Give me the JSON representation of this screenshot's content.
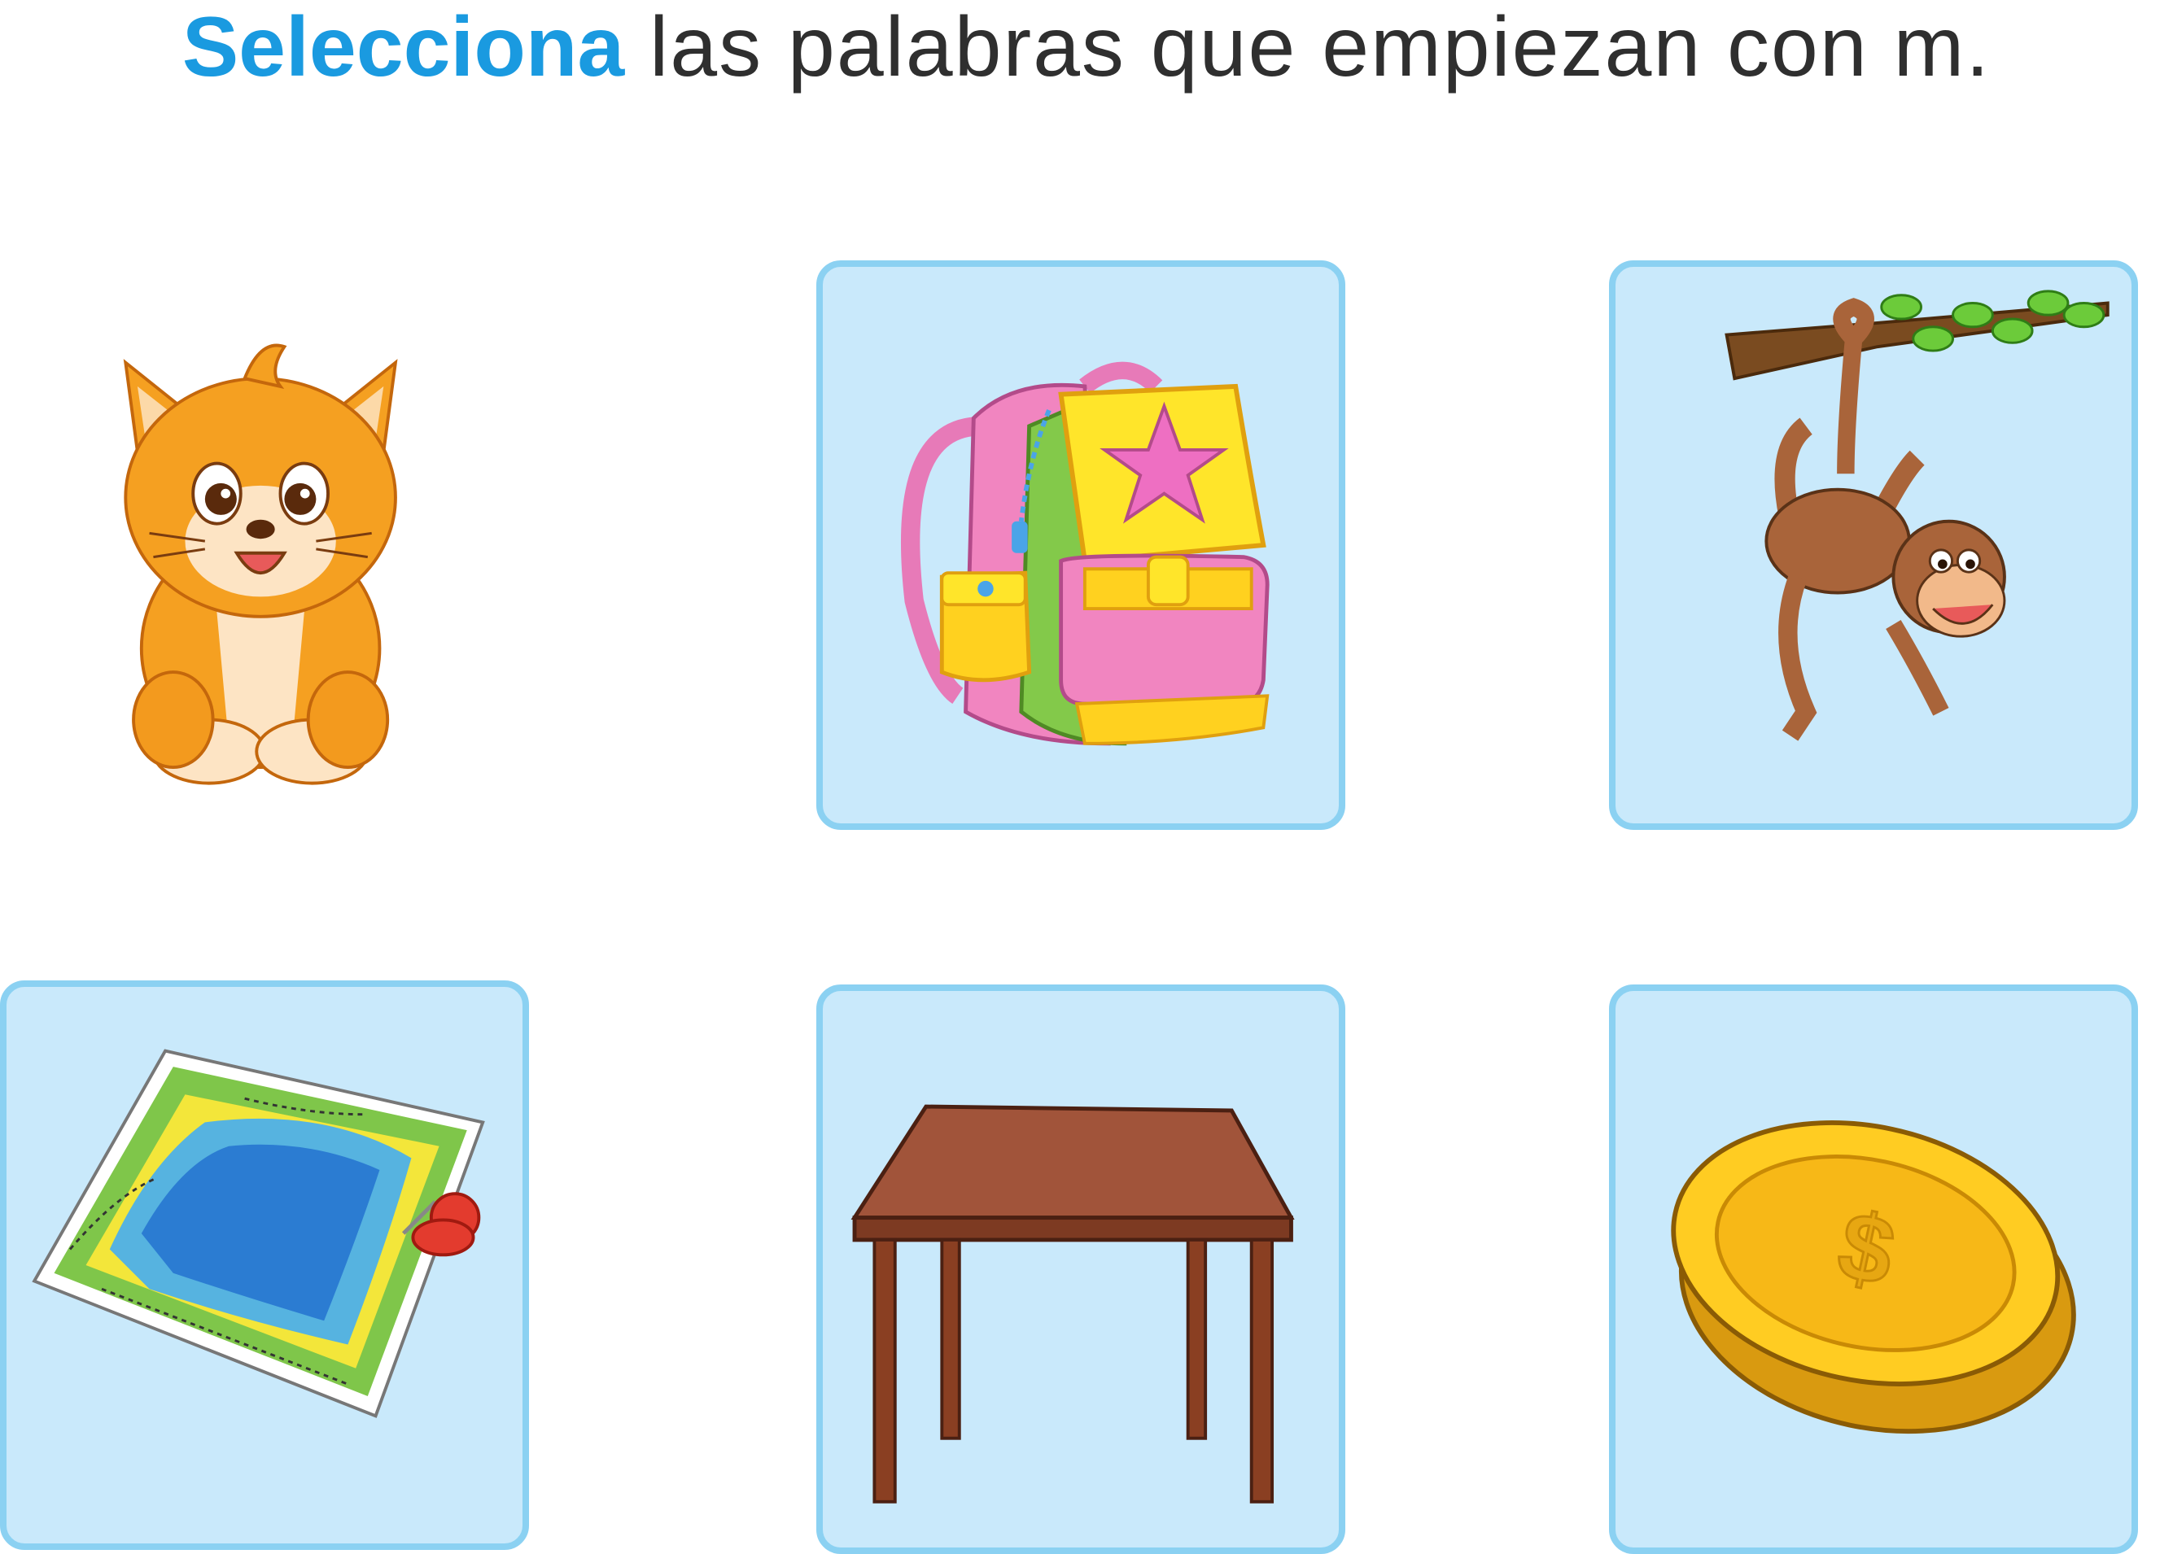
{
  "instruction": {
    "highlight": "Selecciona",
    "rest": "las palabras que empiezan con m."
  },
  "colors": {
    "accent": "#1a9ae0",
    "card_fill": "#c9e9fb",
    "card_border": "#8bd1f2"
  },
  "options": [
    {
      "id": "gato",
      "icon": "cat-icon",
      "selected": false
    },
    {
      "id": "mochila",
      "icon": "backpack-icon",
      "selected": true
    },
    {
      "id": "mono",
      "icon": "monkey-icon",
      "selected": true
    },
    {
      "id": "mapa",
      "icon": "map-icon",
      "selected": true
    },
    {
      "id": "mesa",
      "icon": "table-icon",
      "selected": true
    },
    {
      "id": "moneda",
      "icon": "coin-icon",
      "selected": true
    }
  ]
}
